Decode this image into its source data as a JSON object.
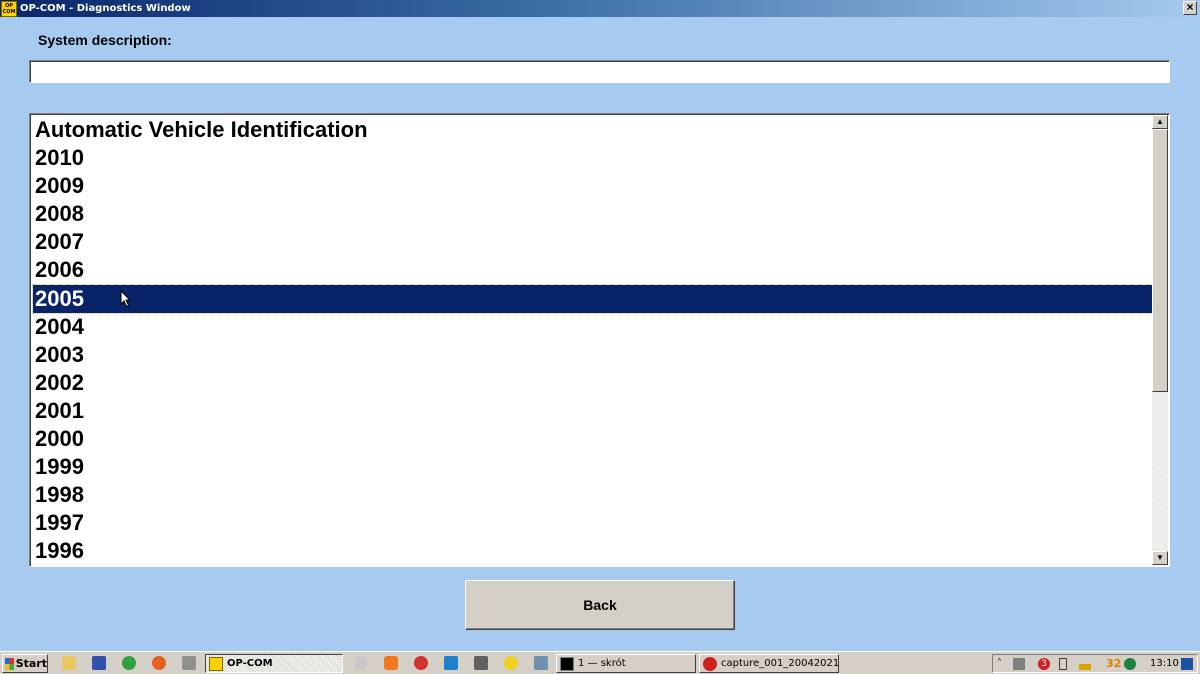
{
  "window": {
    "title": "OP-COM - Diagnostics Window",
    "close_label": "×",
    "app_icon_line1": "OP",
    "app_icon_line2": "COM"
  },
  "system_description": {
    "label": "System description:",
    "value": ""
  },
  "list": {
    "items": [
      "Automatic Vehicle Identification",
      "2010",
      "2009",
      "2008",
      "2007",
      "2006",
      "2005",
      "2004",
      "2003",
      "2002",
      "2001",
      "2000",
      "1999",
      "1998",
      "1997",
      "1996"
    ],
    "selected": "2005",
    "scroll_up": "▲",
    "scroll_down": "▼"
  },
  "back_button": {
    "label": "Back"
  },
  "taskbar": {
    "start_label": "Start",
    "buttons": [
      {
        "label": "OP-COM",
        "icon": "op-com-icon",
        "active": true
      },
      {
        "label": "1 — skrót",
        "icon": "console-icon",
        "active": false
      },
      {
        "label": "capture_001_20042021...",
        "icon": "capture-icon",
        "active": false
      }
    ],
    "tray": {
      "badge_count": "3",
      "temperature": "32",
      "clock": "13:10"
    }
  },
  "colors": {
    "background": "#a6caf0",
    "selection": "#0a246a",
    "titlebar_start": "#0a246a",
    "button_face": "#d4d0c8"
  }
}
